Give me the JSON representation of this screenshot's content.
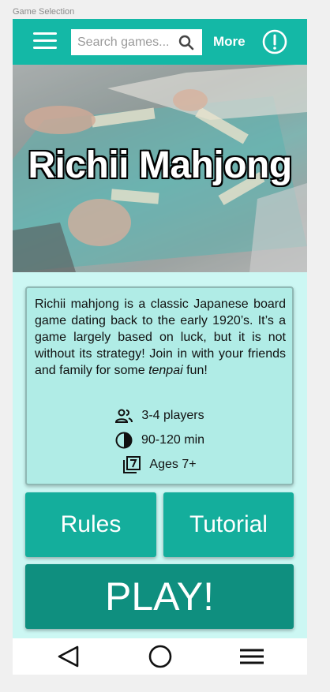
{
  "frame": {
    "label": "Game Selection"
  },
  "topbar": {
    "menu_icon": "hamburger-icon",
    "search_placeholder": "Search games...",
    "search_icon": "search-icon",
    "more_label": "More",
    "alert_icon": "alert-circle-icon"
  },
  "hero": {
    "title": "Richii Mahjong"
  },
  "card": {
    "description_pre": "Richii mahjong is a classic Japanese board game dating back to the early 1920’s. It’s a game largely based on luck, but it is not without its strategy! Join in with your friends and family for some ",
    "description_em": "tenpai",
    "description_post": " fun!",
    "players": "3-4 players",
    "time": "90-120 min",
    "ages": "Ages 7+"
  },
  "buttons": {
    "rules": "Rules",
    "tutorial": "Tutorial",
    "play": "PLAY!"
  },
  "navbar": {
    "back_icon": "back-triangle-icon",
    "home_icon": "home-circle-icon",
    "menu_icon": "menu-lines-icon"
  },
  "colors": {
    "accent": "#14b8a6",
    "button": "#14ae9c",
    "play": "#0f8f7f",
    "background": "#ccf7f3",
    "card": "#b0ece6"
  }
}
